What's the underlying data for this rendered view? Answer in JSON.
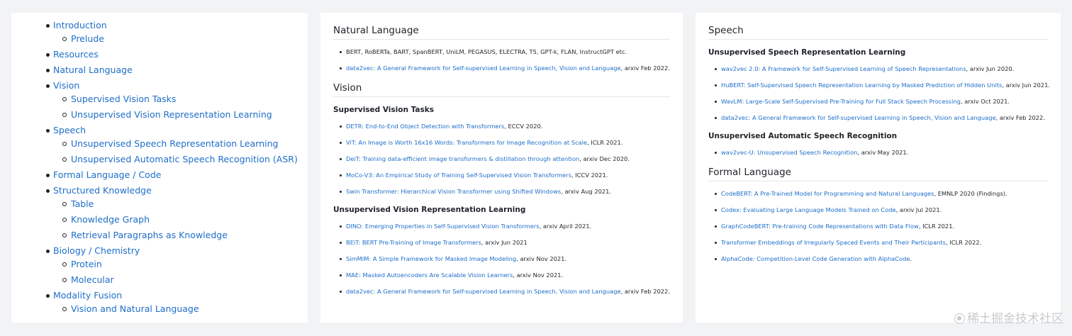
{
  "toc": [
    {
      "label": "Introduction",
      "children": [
        "Prelude"
      ]
    },
    {
      "label": "Resources",
      "children": []
    },
    {
      "label": "Natural Language",
      "children": []
    },
    {
      "label": "Vision",
      "children": [
        "Supervised Vision Tasks",
        "Unsupervised Vision Representation Learning"
      ]
    },
    {
      "label": "Speech",
      "children": [
        "Unsupervised Speech Representation Learning",
        "Unsupervised Automatic Speech Recognition (ASR)"
      ]
    },
    {
      "label": "Formal Language / Code",
      "children": []
    },
    {
      "label": "Structured Knowledge",
      "children": [
        "Table",
        "Knowledge Graph",
        "Retrieval Paragraphs as Knowledge"
      ]
    },
    {
      "label": "Biology / Chemistry",
      "children": [
        "Protein",
        "Molecular"
      ]
    },
    {
      "label": "Modality Fusion",
      "children": [
        "Vision and Natural Language"
      ]
    }
  ],
  "middle": {
    "natural_language": {
      "heading": "Natural Language",
      "items": [
        {
          "link": "",
          "suffix": "BERT, RoBERTa, BART, SpanBERT, UniLM, PEGASUS, ELECTRA, T5, GPT-k, FLAN, InstructGPT etc."
        },
        {
          "link": "data2vec: A General Framework for Self-supervised Learning in Speech, Vision and Language",
          "suffix": ", arxiv Feb 2022."
        }
      ]
    },
    "vision": {
      "heading": "Vision",
      "supervised": {
        "heading": "Supervised Vision Tasks",
        "items": [
          {
            "link": "DETR: End-to-End Object Detection with Transformers",
            "suffix": ", ECCV 2020."
          },
          {
            "link": "ViT: An Image is Worth 16x16 Words: Transformers for Image Recognition at Scale",
            "suffix": ", ICLR 2021."
          },
          {
            "link": "DeiT: Training data-efficient image transformers & distillation through attention",
            "suffix": ", arxiv Dec 2020."
          },
          {
            "link": "MoCo-V3: An Empirical Study of Training Self-Supervised Vision Transformers",
            "suffix": ", ICCV 2021."
          },
          {
            "link": "Swin Transformer: Hierarchical Vision Transformer using Shifted Windows",
            "suffix": ", arxiv Aug 2021."
          }
        ]
      },
      "unsupervised": {
        "heading": "Unsupervised Vision Representation Learning",
        "items": [
          {
            "link": "DINO: Emerging Properties in Self-Supervised Vision Transformers",
            "suffix": ", arxiv April 2021."
          },
          {
            "link": "BEiT: BERT Pre-Training of Image Transformers",
            "suffix": ", arxiv Jun 2021"
          },
          {
            "link": "SimMIM: A Simple Framework for Masked Image Modeling",
            "suffix": ", arxiv Nov 2021."
          },
          {
            "link": "MAE: Masked Autoencoders Are Scalable Vision Learners",
            "suffix": ", arxiv Nov 2021."
          },
          {
            "link": "data2vec: A General Framework for Self-supervised Learning in Speech, Vision and Language",
            "suffix": ", arxiv Feb 2022."
          }
        ]
      }
    }
  },
  "right": {
    "speech": {
      "heading": "Speech",
      "unsup_repr": {
        "heading": "Unsupervised Speech Representation Learning",
        "items": [
          {
            "link": "wav2vec 2.0: A Framework for Self-Supervised Learning of Speech Representations",
            "suffix": ", arxiv Jun 2020."
          },
          {
            "link": "HuBERT: Self-Supervised Speech Representation Learning by Masked Prediction of Hidden Units",
            "suffix": ", arxiv Jun 2021."
          },
          {
            "link": "WavLM: Large-Scale Self-Supervised Pre-Training for Full Stack Speech Processing",
            "suffix": ", arxiv Oct 2021."
          },
          {
            "link": "data2vec: A General Framework for Self-supervised Learning in Speech, Vision and Language",
            "suffix": ", arxiv Feb 2022."
          }
        ]
      },
      "unsup_asr": {
        "heading": "Unsupervised Automatic Speech Recognition",
        "items": [
          {
            "link": "wav2vec-U: Unsupervised Speech Recognition",
            "suffix": ", arxiv May 2021."
          }
        ]
      }
    },
    "formal_language": {
      "heading": "Formal Language",
      "items": [
        {
          "link": "CodeBERT: A Pre-Trained Model for Programming and Natural Languages",
          "suffix": ", EMNLP 2020 (Findings)."
        },
        {
          "link": "Codex: Evaluating Large Language Models Trained on Code",
          "suffix": ", arxiv Jul 2021."
        },
        {
          "link": "GraphCodeBERT: Pre-training Code Representations with Data Flow",
          "suffix": ", ICLR 2021."
        },
        {
          "link": "Transformer Embeddings of Irregularly Spaced Events and Their Participants",
          "suffix": ", ICLR 2022."
        },
        {
          "link": "AlphaCode: Competition-Level Code Generation with AlphaCode",
          "suffix": "."
        }
      ]
    }
  },
  "watermark": "稀土掘金技术社区",
  "colors": {
    "link": "#1e6ec8",
    "text": "#1f2329",
    "background": "#f2f3f5",
    "panel": "#ffffff"
  }
}
